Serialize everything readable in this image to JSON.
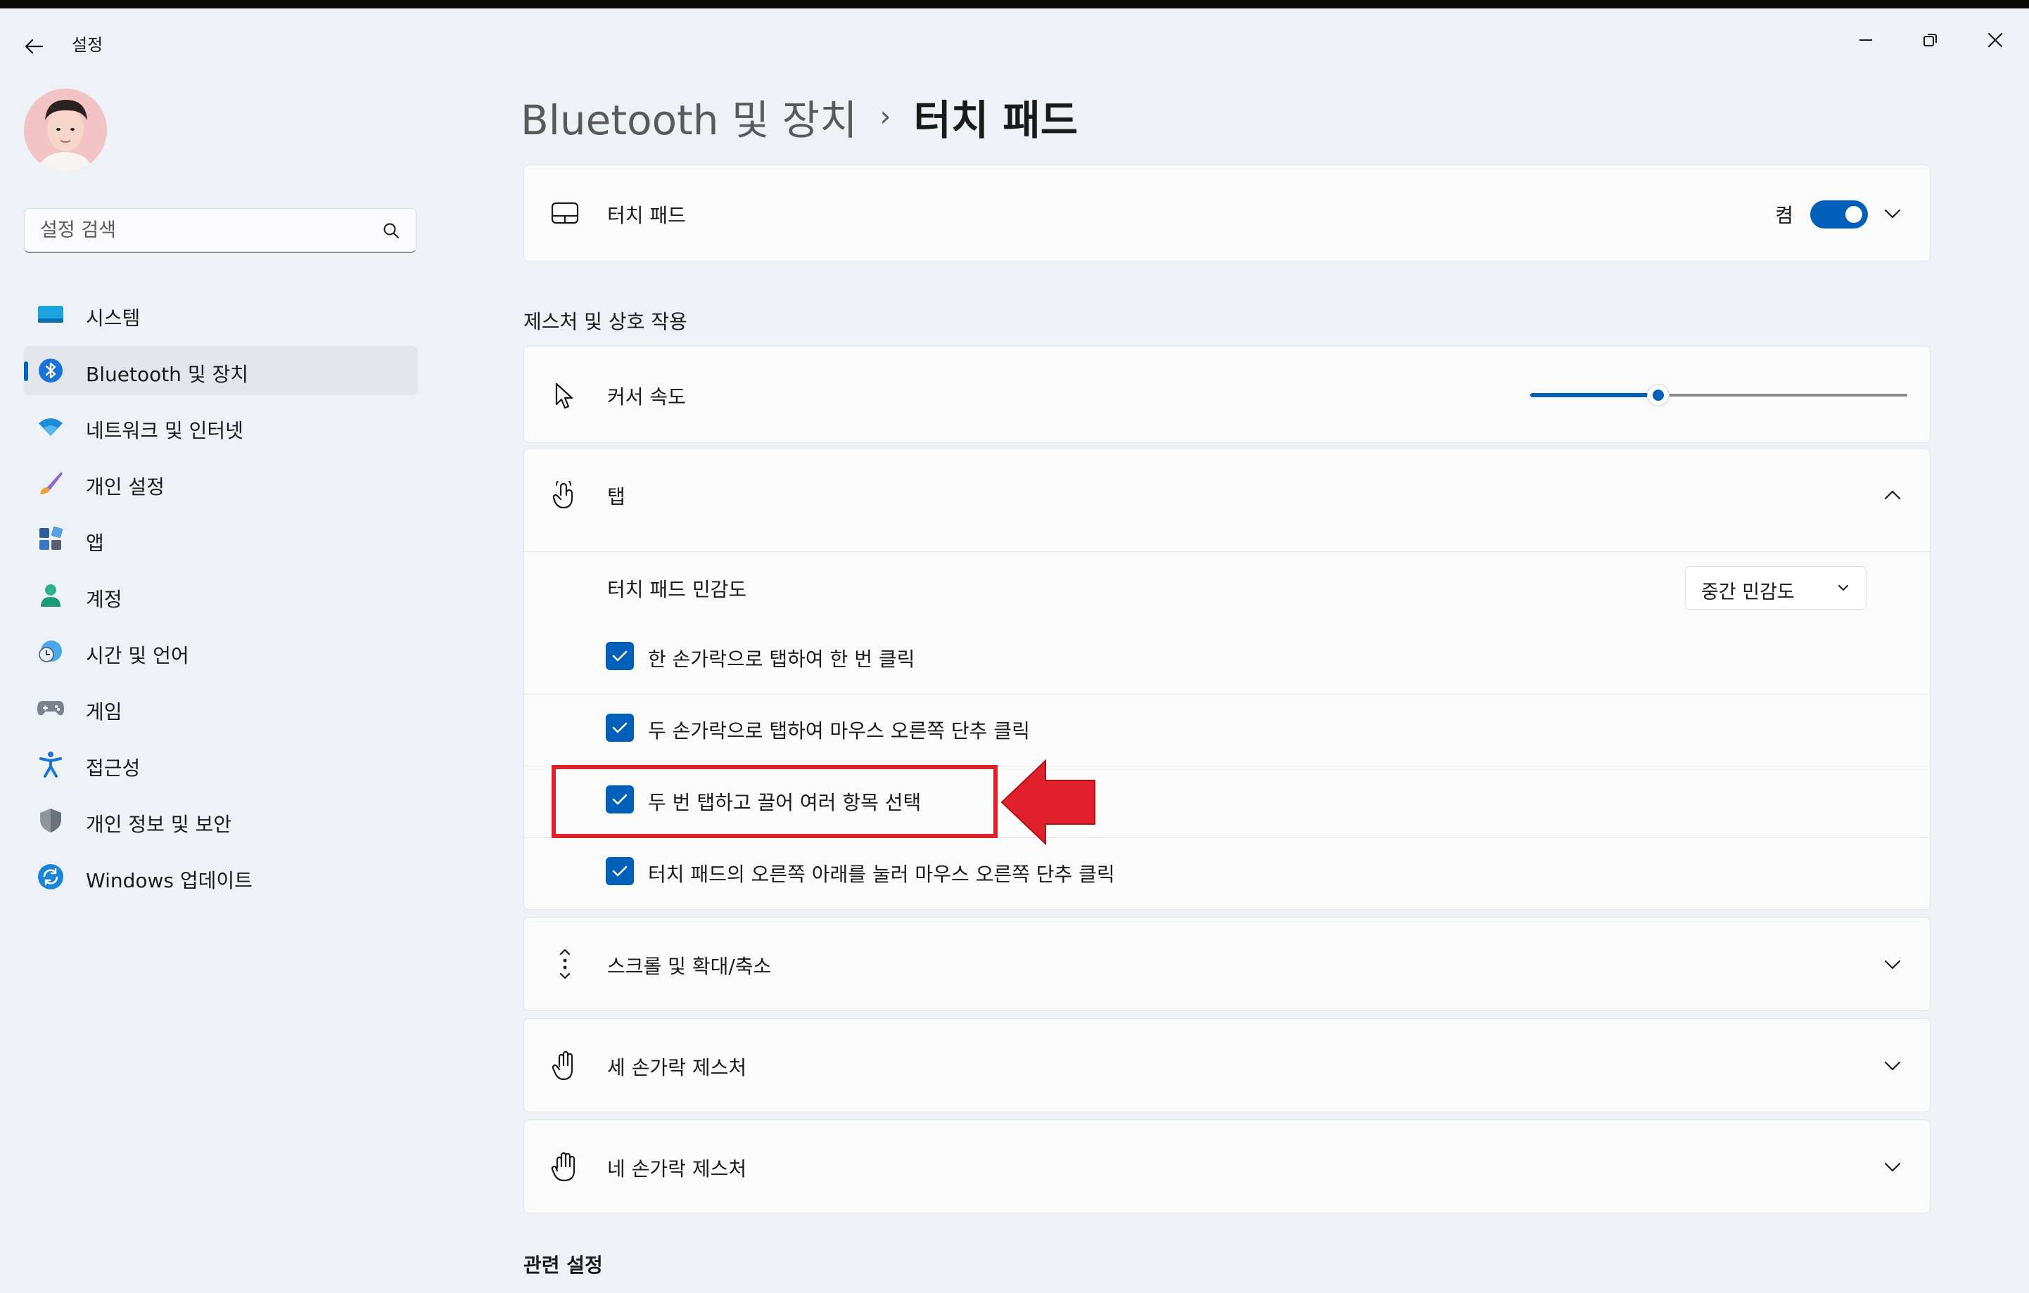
{
  "window": {
    "title": "설정",
    "back_icon": "arrow-left-icon",
    "controls": [
      "minimize-icon",
      "restore-icon",
      "close-icon"
    ]
  },
  "search": {
    "placeholder": "설정 검색",
    "icon": "search-icon"
  },
  "sidebar": {
    "items": [
      {
        "label": "시스템",
        "icon": "system-icon",
        "active": false
      },
      {
        "label": "Bluetooth 및 장치",
        "icon": "bluetooth-icon",
        "active": true
      },
      {
        "label": "네트워크 및 인터넷",
        "icon": "wifi-icon",
        "active": false
      },
      {
        "label": "개인 설정",
        "icon": "brush-icon",
        "active": false
      },
      {
        "label": "앱",
        "icon": "apps-icon",
        "active": false
      },
      {
        "label": "계정",
        "icon": "account-icon",
        "active": false
      },
      {
        "label": "시간 및 언어",
        "icon": "clock-globe-icon",
        "active": false
      },
      {
        "label": "게임",
        "icon": "gamepad-icon",
        "active": false
      },
      {
        "label": "접근성",
        "icon": "accessibility-icon",
        "active": false
      },
      {
        "label": "개인 정보 및 보안",
        "icon": "shield-icon",
        "active": false
      },
      {
        "label": "Windows 업데이트",
        "icon": "update-icon",
        "active": false
      }
    ]
  },
  "breadcrumb": {
    "parent": "Bluetooth 및 장치",
    "separator": "›",
    "current": "터치 패드"
  },
  "touchpad_card": {
    "label": "터치 패드",
    "toggle_label": "켬",
    "toggle_on": true
  },
  "gestures_section": {
    "title": "제스처 및 상호 작용"
  },
  "cursor_speed": {
    "label": "커서 속도",
    "value_fraction": 0.34
  },
  "taps": {
    "label": "탭",
    "sensitivity_label": "터치 패드 민감도",
    "sensitivity_value": "중간 민감도",
    "options": [
      {
        "label": "한 손가락으로 탭하여 한 번 클릭",
        "checked": true
      },
      {
        "label": "두 손가락으로 탭하여 마우스 오른쪽 단추 클릭",
        "checked": true
      },
      {
        "label": "두 번 탭하고 끌어 여러 항목 선택",
        "checked": true
      },
      {
        "label": "터치 패드의 오른쪽 아래를 눌러 마우스 오른쪽 단추 클릭",
        "checked": true
      }
    ]
  },
  "scroll_zoom": {
    "label": "스크롤 및 확대/축소"
  },
  "three_finger": {
    "label": "세 손가락 제스처"
  },
  "four_finger": {
    "label": "네 손가락 제스처"
  },
  "related": {
    "title": "관련 설정"
  },
  "colors": {
    "accent": "#005fb8",
    "annotation_red": "#e0202a"
  }
}
